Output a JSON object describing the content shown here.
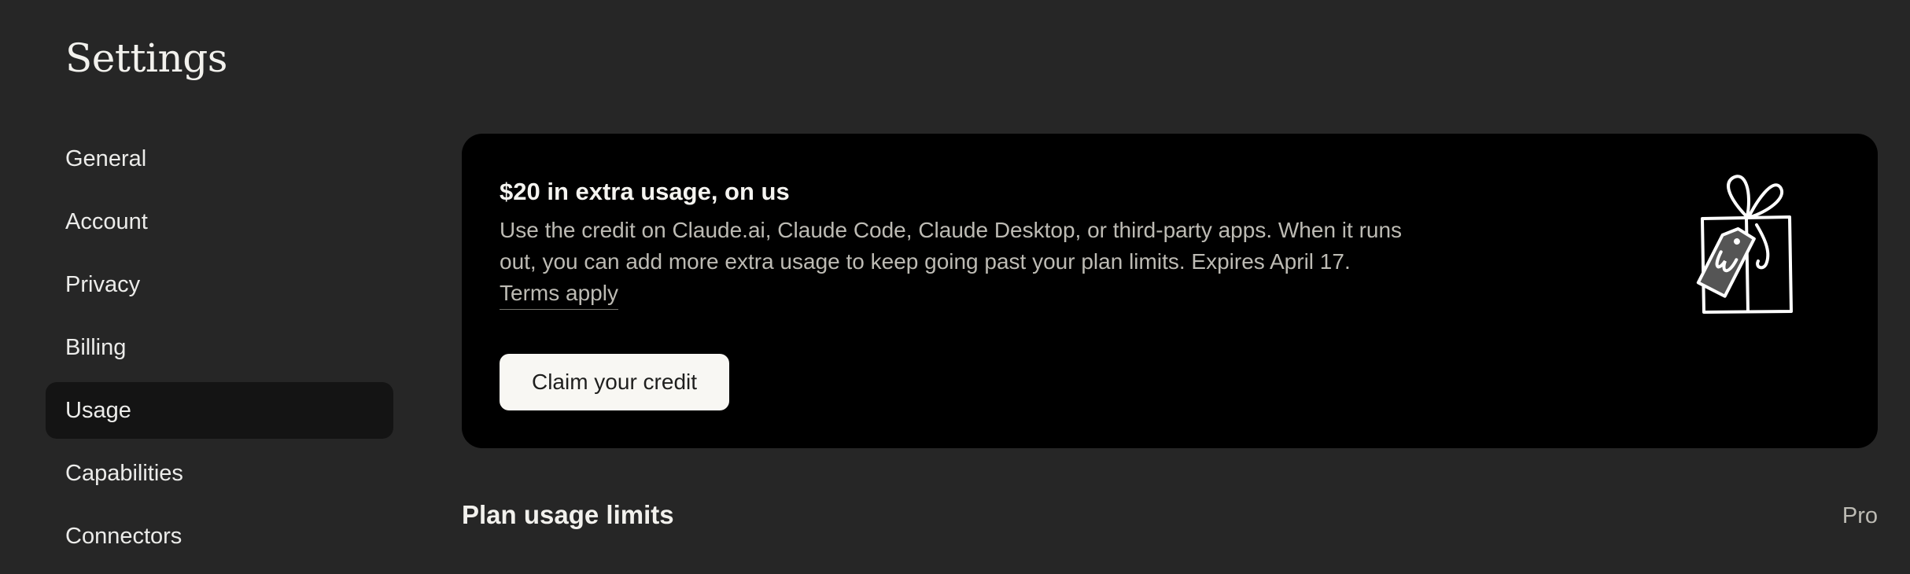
{
  "page": {
    "title": "Settings"
  },
  "sidebar": {
    "items": [
      {
        "label": "General"
      },
      {
        "label": "Account"
      },
      {
        "label": "Privacy"
      },
      {
        "label": "Billing"
      },
      {
        "label": "Usage",
        "active": true
      },
      {
        "label": "Capabilities"
      },
      {
        "label": "Connectors"
      }
    ]
  },
  "promo": {
    "title": "$20 in extra usage, on us",
    "description": "Use the credit on Claude.ai, Claude Code, Claude Desktop, or third-party apps. When it runs out, you can add more extra usage to keep going past your plan limits. Expires April 17.",
    "terms_label": "Terms apply",
    "button_label": "Claim your credit",
    "illustration_icon": "gift-box-icon"
  },
  "plan_usage": {
    "title": "Plan usage limits",
    "plan_name": "Pro"
  },
  "colors": {
    "background": "#262626",
    "card_background": "#000000",
    "active_item_background": "#141414",
    "button_background": "#f8f7f3"
  }
}
